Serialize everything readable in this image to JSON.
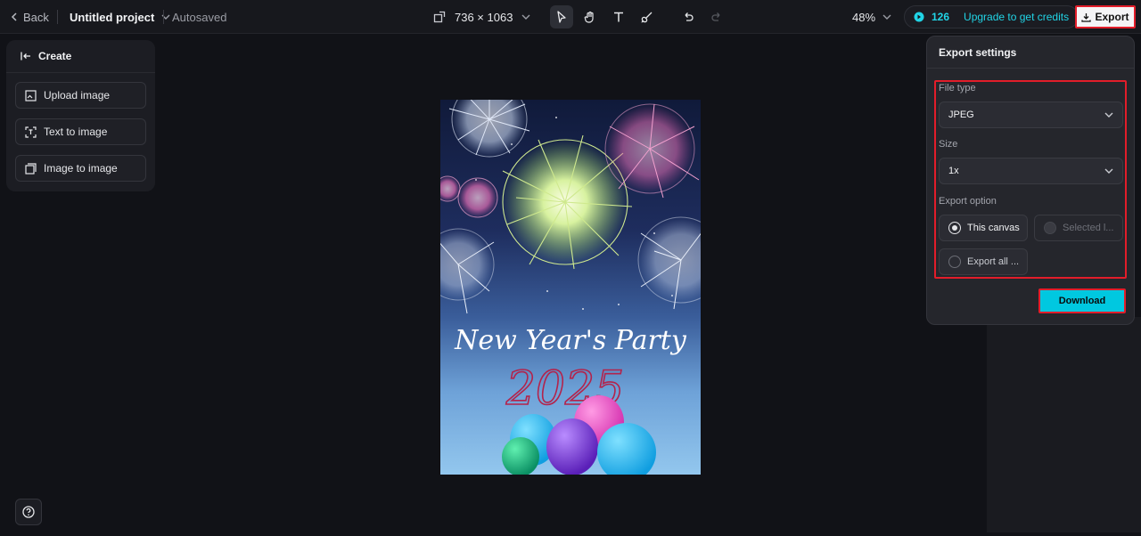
{
  "topbar": {
    "back_label": "Back",
    "project_title": "Untitled project",
    "save_status": "Autosaved",
    "canvas_size": "736 × 1063",
    "zoom": "48%",
    "credits": "126",
    "upgrade_label": "Upgrade to get credits",
    "export_label": "Export"
  },
  "tools": [
    "select-tool",
    "hand-tool",
    "text-tool",
    "draw-tool",
    "undo",
    "redo"
  ],
  "left_panel": {
    "header": "Create",
    "items": [
      {
        "label": "Upload image",
        "icon": "upload-image-icon"
      },
      {
        "label": "Text to image",
        "icon": "text-to-image-icon"
      },
      {
        "label": "Image to image",
        "icon": "image-to-image-icon"
      }
    ]
  },
  "canvas": {
    "headline": "New Year's Party",
    "year": "2025"
  },
  "export_settings": {
    "title": "Export settings",
    "file_type_label": "File type",
    "file_type_value": "JPEG",
    "size_label": "Size",
    "size_value": "1x",
    "export_option_label": "Export option",
    "options": [
      {
        "label": "This canvas",
        "selected": true,
        "enabled": true
      },
      {
        "label": "Selected l...",
        "selected": false,
        "enabled": false
      },
      {
        "label": "Export all ...",
        "selected": false,
        "enabled": true
      }
    ],
    "download_label": "Download"
  },
  "colors": {
    "accent": "#00c8e0",
    "highlight": "#e21d2a",
    "background": "#111217"
  }
}
